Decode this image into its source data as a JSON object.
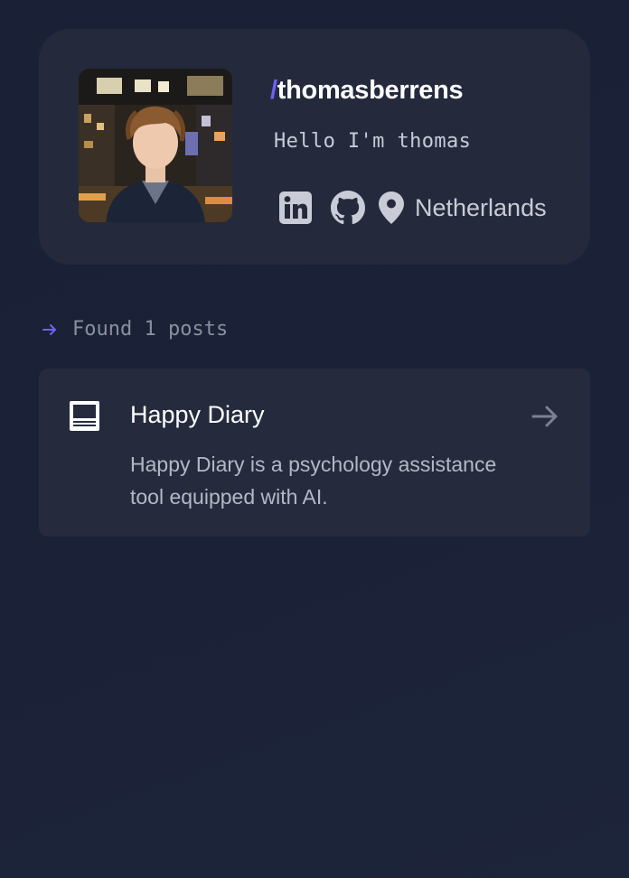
{
  "profile": {
    "avatar_alt": "profile photo",
    "handle_prefix": "/",
    "handle": "thomasberrens",
    "bio": "Hello I'm thomas",
    "socials": [
      {
        "icon": "linkedin-icon"
      },
      {
        "icon": "github-icon"
      }
    ],
    "location_icon": "location-pin-icon",
    "location": "Netherlands"
  },
  "results": {
    "found_text": "Found 1 posts",
    "accent_color": "#6b63f5"
  },
  "posts": [
    {
      "icon": "document-icon",
      "title": "Happy Diary",
      "description": "Happy Diary is a psychology assistance tool equipped with AI.",
      "arrow_icon": "arrow-right-icon"
    }
  ],
  "colors": {
    "background": "#1b2238",
    "card": "#242a3c",
    "accent": "#6b63f5"
  }
}
